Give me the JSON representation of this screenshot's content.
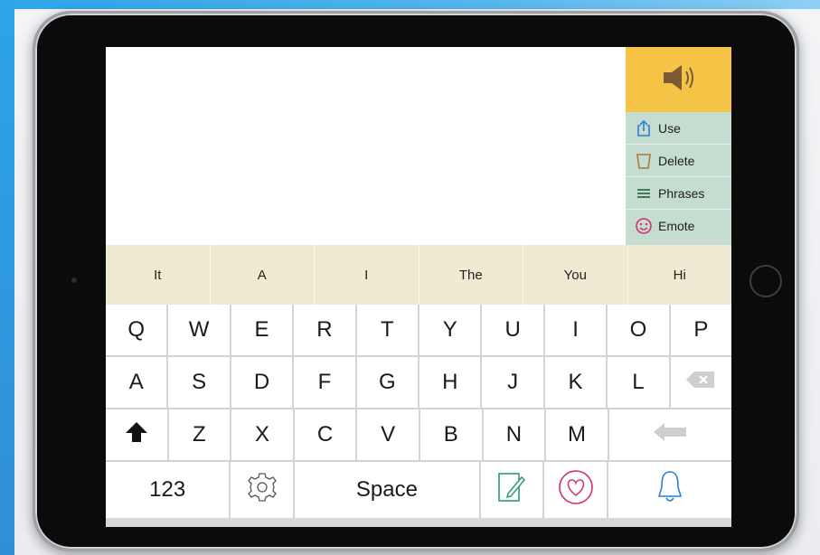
{
  "speak": {
    "icon": "speaker-icon"
  },
  "side_menu": [
    {
      "label": "Use",
      "icon": "share-icon"
    },
    {
      "label": "Delete",
      "icon": "trash-icon"
    },
    {
      "label": "Phrases",
      "icon": "list-icon"
    },
    {
      "label": "Emote",
      "icon": "smiley-icon"
    }
  ],
  "predictions": [
    "It",
    "A",
    "I",
    "The",
    "You",
    "Hi"
  ],
  "keyboard": {
    "row1": [
      "Q",
      "W",
      "E",
      "R",
      "T",
      "Y",
      "U",
      "I",
      "O",
      "P"
    ],
    "row2": [
      "A",
      "S",
      "D",
      "F",
      "G",
      "H",
      "J",
      "K",
      "L"
    ],
    "row3": [
      "Z",
      "X",
      "C",
      "V",
      "B",
      "N",
      "M"
    ],
    "numbers_label": "123",
    "space_label": "Space",
    "icons": {
      "backspace": "backspace-icon",
      "shift": "shift-arrow-icon",
      "return": "return-arrow-icon",
      "settings": "gear-icon",
      "notes": "notepad-pencil-icon",
      "favorites": "heart-icon",
      "bell": "bell-icon"
    }
  },
  "colors": {
    "speak_bg": "#f5c446",
    "side_panel_bg": "#c5ddd0",
    "prediction_bg": "#efebd3",
    "heart": "#d4306e",
    "bell": "#2d7fd3",
    "notes": "#2f9a72"
  }
}
